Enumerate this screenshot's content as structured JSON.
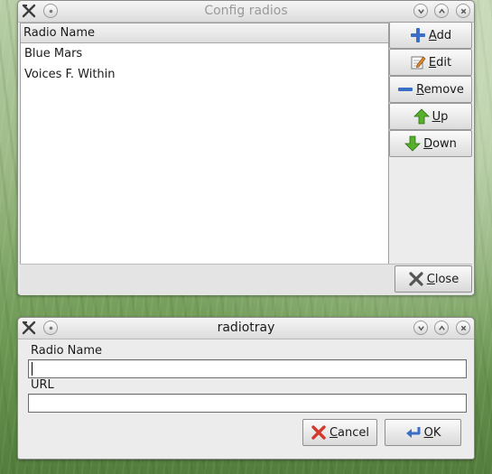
{
  "config_window": {
    "title": "Config radios",
    "list": {
      "column_header": "Radio Name",
      "rows": [
        "Blue Mars",
        "Voices F. Within"
      ]
    },
    "buttons": {
      "add": {
        "mnemonic": "A",
        "rest": "dd",
        "icon": "plus-icon"
      },
      "edit": {
        "mnemonic": "E",
        "rest": "dit",
        "icon": "edit-icon"
      },
      "remove": {
        "mnemonic": "R",
        "rest": "emove",
        "icon": "minus-icon"
      },
      "up": {
        "mnemonic": "U",
        "rest": "p",
        "icon": "arrow-up-icon"
      },
      "down": {
        "mnemonic": "D",
        "rest": "own",
        "icon": "arrow-down-icon"
      },
      "close": {
        "mnemonic": "C",
        "rest": "lose",
        "icon": "close-x-icon"
      }
    }
  },
  "dialog": {
    "title": "radiotray",
    "radio_name_label": "Radio Name",
    "radio_name_value": "",
    "url_label": "URL",
    "url_value": "",
    "cancel": {
      "mnemonic": "C",
      "rest": "ancel",
      "icon": "cancel-icon"
    },
    "ok": {
      "mnemonic": "O",
      "rest": "K",
      "icon": "ok-icon"
    }
  },
  "colors": {
    "accent_blue": "#3b6fc7",
    "arrow_green": "#56b02c",
    "cancel_red": "#d23b2b"
  }
}
